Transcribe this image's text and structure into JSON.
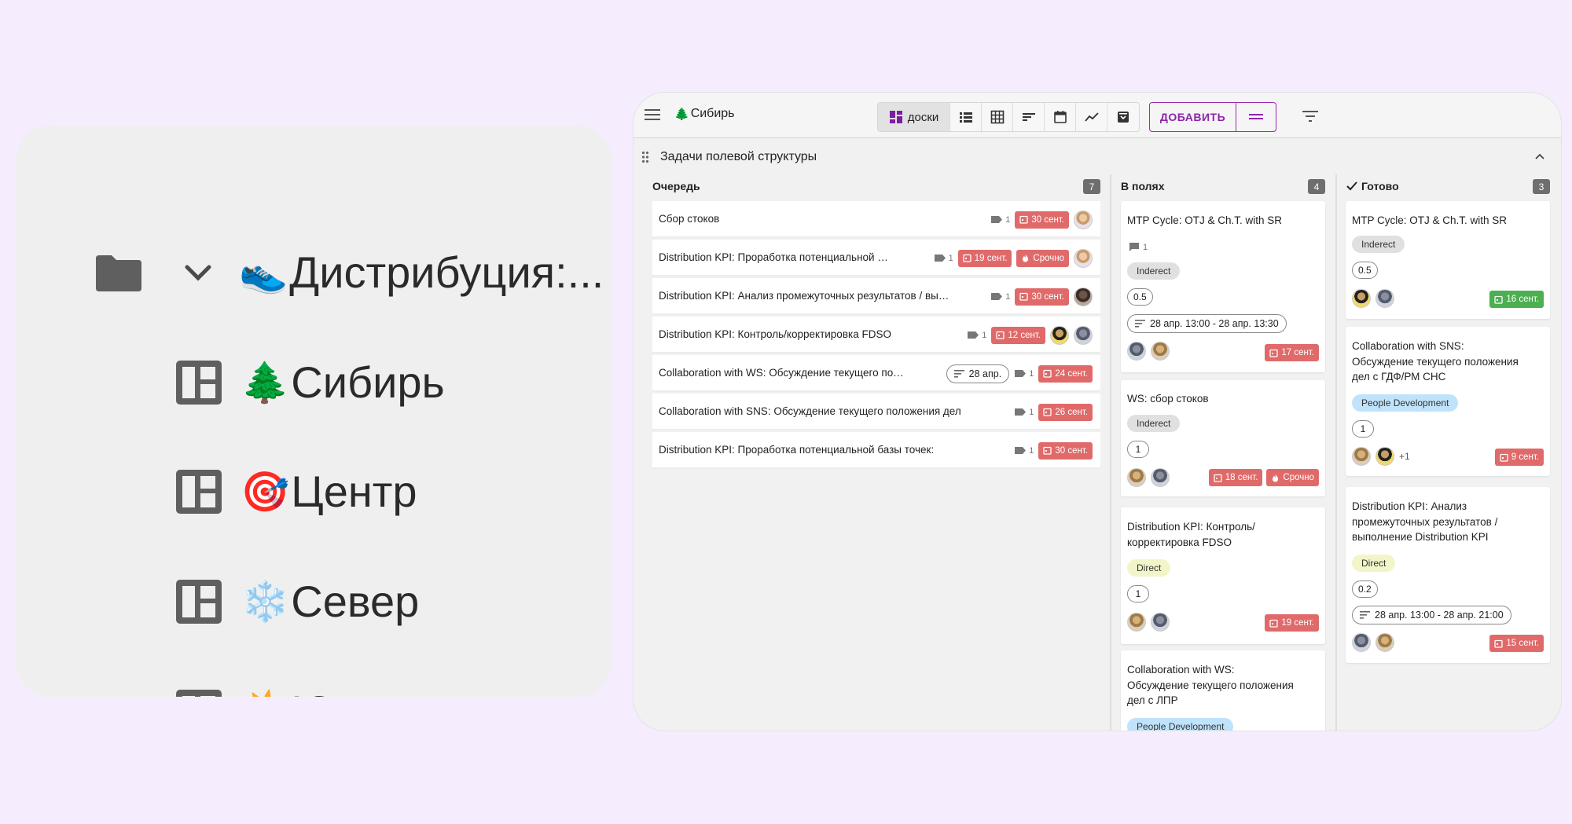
{
  "tree": {
    "root": {
      "emoji": "👟",
      "label": "Дистрибуция:..."
    },
    "boards": [
      {
        "emoji": "🌲",
        "label": "Сибирь"
      },
      {
        "emoji": "🎯",
        "label": "Центр"
      },
      {
        "emoji": "❄️",
        "label": "Север"
      },
      {
        "emoji": "☀️",
        "label": "Юг"
      }
    ]
  },
  "app": {
    "project": {
      "emoji": "🌲",
      "title": "Сибирь"
    },
    "views": {
      "active_label": "доски"
    },
    "add_label": "ДОБАВИТЬ",
    "group_title": "Задачи полевой структуры",
    "colors": {
      "accent": "#9c27b0",
      "red_badge": "#e06a6a",
      "green_badge": "#4caf50"
    },
    "columns": {
      "queue": {
        "title": "Очередь",
        "count": "7"
      },
      "field": {
        "title": "В полях",
        "count": "4"
      },
      "done": {
        "title": "Готово",
        "count": "3"
      }
    },
    "queue_rows": [
      {
        "title": "Сбор стоков",
        "comments": "1",
        "due": "30 сент."
      },
      {
        "title": "Distribution KPI: Проработка потенциальной базы",
        "comments": "1",
        "due": "19 сент.",
        "urgent": "Срочно"
      },
      {
        "title": "Distribution KPI: Анализ промежуточных результатов / выполнение",
        "comments": "1",
        "due": "30 сент."
      },
      {
        "title": "Distribution KPI: Контроль/корректировка FDSO",
        "comments": "1",
        "due": "12 сент."
      },
      {
        "title": "Collaboration with WS: Обсуждение текущего положения",
        "start": "28 апр.",
        "comments": "1",
        "due": "24 сент."
      },
      {
        "title": "Collaboration with SNS: Обсуждение текущего положения дел",
        "comments": "1",
        "due": "26 сент."
      },
      {
        "title": "Distribution KPI: Проработка потенциальной базы точек:",
        "comments": "1",
        "due": "30 сент."
      }
    ],
    "field_cards": [
      {
        "title": "MTP Cycle: OTJ & Ch.T. with SR",
        "comments": "1",
        "tag": "Inderect",
        "num": "0.5",
        "range": "28 апр. 13:00 - 28 апр. 13:30",
        "due": "17 сент."
      },
      {
        "title": "WS: сбор стоков",
        "tag": "Inderect",
        "num": "1",
        "due": "18 сент.",
        "urgent": "Срочно"
      },
      {
        "title1": "Distribution KPI: Контроль/",
        "title2": "корректировка FDSO",
        "tag": "Direct",
        "num": "1",
        "due": "19 сент."
      },
      {
        "title1": "Collaboration with WS:",
        "title2": "Обсуждение текущего положения",
        "title3": "дел с ЛПР",
        "tag": "People Development"
      }
    ],
    "done_cards": [
      {
        "title": "MTP Cycle: OTJ & Ch.T. with SR",
        "tag": "Inderect",
        "num": "0.5",
        "due": "16 сент."
      },
      {
        "title1": "Collaboration with SNS:",
        "title2": "Обсуждение текущего положения",
        "title3": "дел с ГДФ/РМ СНС",
        "tag": "People Development",
        "num": "1",
        "extra": "+1",
        "due": "9 сент."
      },
      {
        "title1": "Distribution KPI: Анализ",
        "title2": "промежуточных результатов /",
        "title3": "выполнение Distribution KPI",
        "tag": "Direct",
        "num": "0.2",
        "range": "28 апр. 13:00 - 28 апр. 21:00",
        "due": "15 сент."
      }
    ]
  }
}
